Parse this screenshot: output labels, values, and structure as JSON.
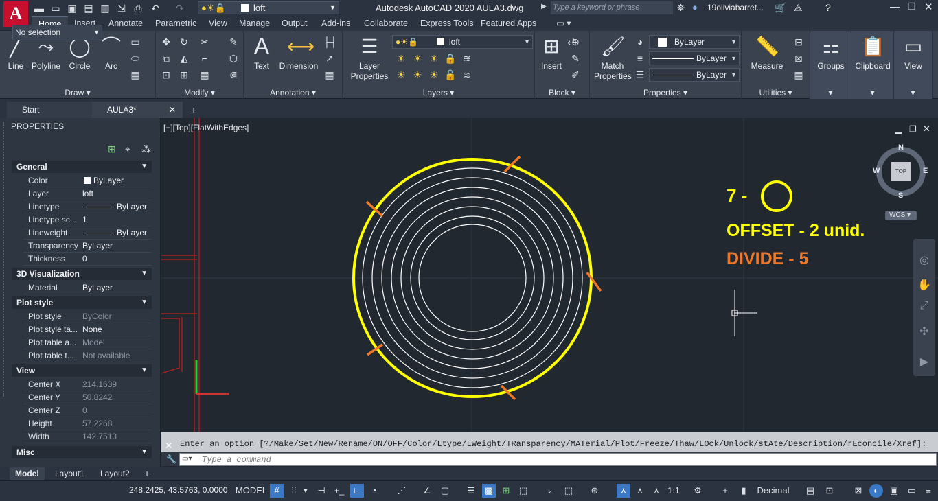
{
  "title_bar": {
    "app_title": "Autodesk AutoCAD 2020    AULA3.dwg",
    "search_placeholder": "Type a keyword or phrase",
    "user": "19oliviabarret...",
    "qat_layer": "loft"
  },
  "ribbon_tabs": [
    "Home",
    "Insert",
    "Annotate",
    "Parametric",
    "View",
    "Manage",
    "Output",
    "Add-ins",
    "Collaborate",
    "Express Tools",
    "Featured Apps"
  ],
  "draw": {
    "line": "Line",
    "polyline": "Polyline",
    "circle": "Circle",
    "arc": "Arc",
    "title": "Draw"
  },
  "modify": {
    "title": "Modify"
  },
  "annotation": {
    "text": "Text",
    "dimension": "Dimension",
    "title": "Annotation"
  },
  "layers": {
    "layer_properties_l1": "Layer",
    "layer_properties_l2": "Properties",
    "current_layer": "loft",
    "title": "Layers"
  },
  "block": {
    "insert": "Insert",
    "title": "Block"
  },
  "properties_panel": {
    "match_l1": "Match",
    "match_l2": "Properties",
    "color": "ByLayer",
    "linetype": "ByLayer",
    "lineweight": "ByLayer",
    "title": "Properties"
  },
  "utilities": {
    "measure": "Measure",
    "title": "Utilities"
  },
  "groups": {
    "label": "Groups"
  },
  "clipboard": {
    "label": "Clipboard"
  },
  "view_panel": {
    "label": "View"
  },
  "doc_tabs": {
    "start": "Start",
    "current": "AULA3*"
  },
  "palette": {
    "title": "PROPERTIES",
    "selection": "No selection",
    "general": {
      "title": "General",
      "rows": [
        [
          "Color",
          "ByLayer"
        ],
        [
          "Layer",
          "loft"
        ],
        [
          "Linetype",
          "ByLayer"
        ],
        [
          "Linetype sc...",
          "1"
        ],
        [
          "Lineweight",
          "ByLayer"
        ],
        [
          "Transparency",
          "ByLayer"
        ],
        [
          "Thickness",
          "0"
        ]
      ]
    },
    "viz3d": {
      "title": "3D Visualization",
      "rows": [
        [
          "Material",
          "ByLayer"
        ]
      ]
    },
    "plot": {
      "title": "Plot style",
      "rows": [
        [
          "Plot style",
          "ByColor"
        ],
        [
          "Plot style ta...",
          "None"
        ],
        [
          "Plot table a...",
          "Model"
        ],
        [
          "Plot table t...",
          "Not available"
        ]
      ]
    },
    "view": {
      "title": "View",
      "rows": [
        [
          "Center X",
          "214.1639"
        ],
        [
          "Center Y",
          "50.8242"
        ],
        [
          "Center Z",
          "0"
        ],
        [
          "Height",
          "57.2268"
        ],
        [
          "Width",
          "142.7513"
        ]
      ]
    },
    "misc": {
      "title": "Misc"
    }
  },
  "viewport": {
    "label": "[−][Top][FlatWithEdges]",
    "annot_num": "7 -",
    "annot_offset": "OFFSET - 2 unid.",
    "annot_divide": "DIVIDE - 5"
  },
  "viewcube": {
    "n": "N",
    "s": "S",
    "e": "E",
    "w": "W",
    "face": "TOP",
    "wcs": "WCS"
  },
  "command": {
    "history": "Enter an option [?/Make/Set/New/Rename/ON/OFF/Color/Ltype/LWeight/TRansparency/MATerial/Plot/Freeze/Thaw/LOck/Unlock/stAte/Description/rEconcile/Xref]:",
    "placeholder": "Type a command"
  },
  "layout_tabs": [
    "Model",
    "Layout1",
    "Layout2"
  ],
  "statusbar": {
    "coords": "248.2425, 43.5763, 0.0000",
    "space": "MODEL",
    "scale": "1:1",
    "units": "Decimal"
  },
  "colors": {
    "accent": "#3b78c6",
    "annot_yellow": "#ffff00",
    "annot_orange": "#f0782a",
    "circle_yellow": "#ffff00",
    "circle_white": "#ffffff",
    "marker_orange": "#f0782a",
    "bg": "#212830"
  }
}
